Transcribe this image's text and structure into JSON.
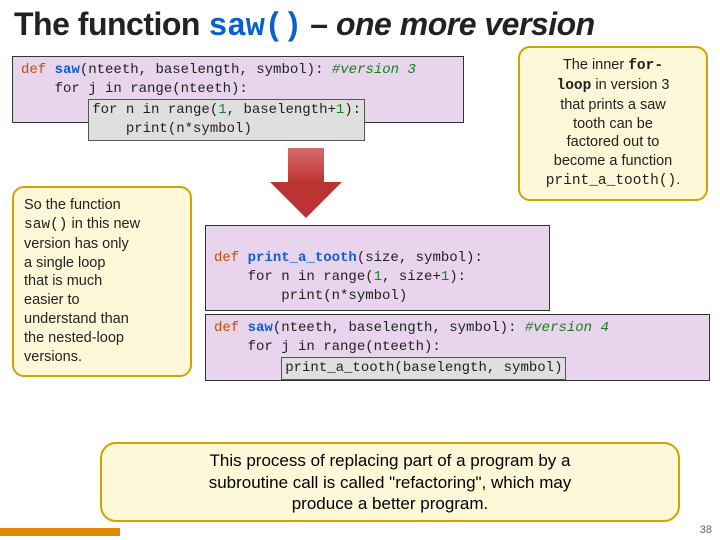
{
  "title": {
    "pre": "The function ",
    "fn": "saw()",
    "dash": " – ",
    "italic": "one more version"
  },
  "code_v3": {
    "l1a": "def ",
    "l1b": "saw",
    "l1c": "(nteeth, baselength, symbol): ",
    "l1d": "#version 3",
    "l2a": "    for j in range(nteeth):",
    "l3a": "for n in range(",
    "l3b": "1",
    "l3c": ", baselength+",
    "l3d": "1",
    "l3e": "):",
    "l4a": "    print(n*symbol)"
  },
  "callout_right": {
    "t1": "The inner ",
    "t1b": "for-",
    "t2a": "loop",
    "t2b": " in version 3",
    "t3": "that prints a saw",
    "t4": "tooth can be",
    "t5": "factored out to",
    "t6": "become a function",
    "t7": "print_a_tooth()",
    "t7b": "."
  },
  "callout_left": {
    "t1": "So the function",
    "t2": "saw()",
    "t2b": " in this new",
    "t3": "version has only",
    "t4": "a single loop",
    "t5": "that is much",
    "t6": "easier to",
    "t7": "understand than",
    "t8": "the nested-loop",
    "t9": "versions."
  },
  "code_pat": {
    "l1a": "def ",
    "l1b": "print_a_tooth",
    "l1c": "(size, symbol):",
    "l2a": "    for n in range(",
    "l2b": "1",
    "l2c": ", size+",
    "l2d": "1",
    "l2e": "):",
    "l3": "        print(n*symbol)"
  },
  "code_v4": {
    "l1a": "def ",
    "l1b": "saw",
    "l1c": "(nteeth, baselength, symbol): ",
    "l1d": "#version 4",
    "l2": "    for j in range(nteeth):",
    "l3": "print_a_tooth(baselength, symbol)"
  },
  "bottom": {
    "t1": "This process of replacing part of a program by a",
    "t2": "subroutine call is called \"refactoring\", which may",
    "t3": "produce a better program."
  },
  "pagenum": "38"
}
